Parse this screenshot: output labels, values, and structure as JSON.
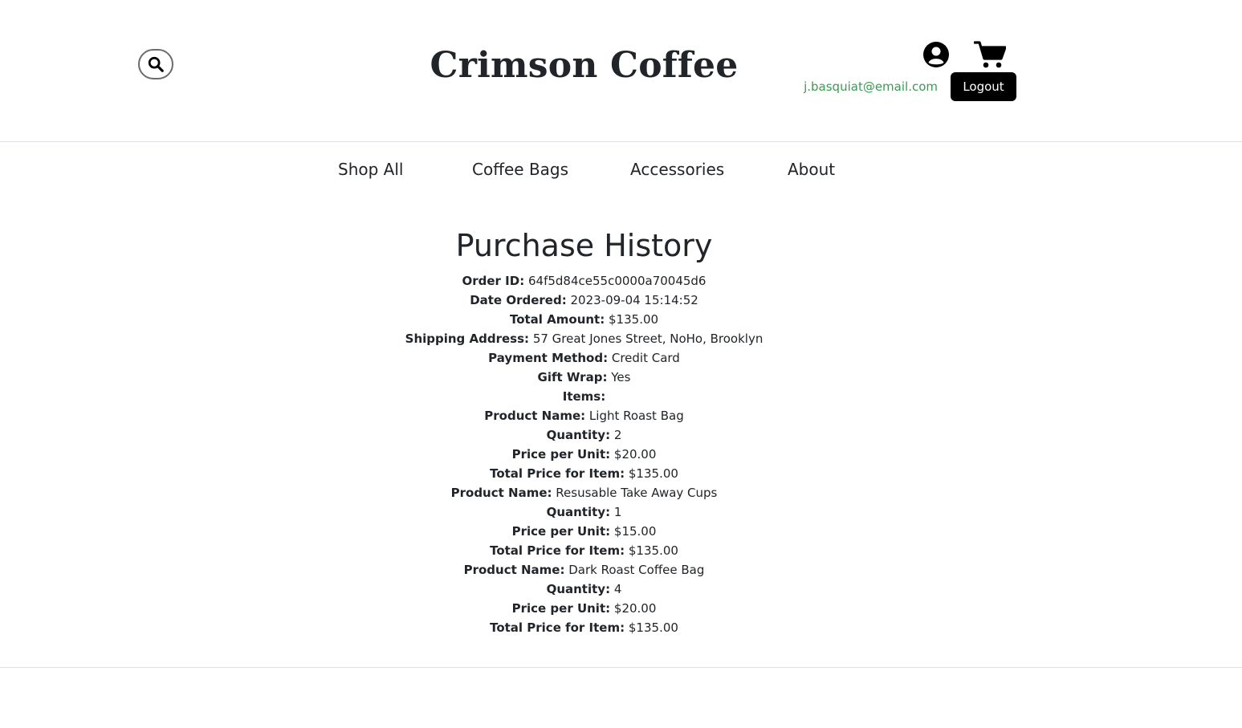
{
  "header": {
    "brand": "Crimson Coffee",
    "user_email": "j.basquiat@email.com",
    "logout_label": "Logout",
    "icons": [
      "search-icon",
      "account-icon",
      "cart-icon"
    ]
  },
  "nav": {
    "items": [
      {
        "label": "Shop All"
      },
      {
        "label": "Coffee Bags"
      },
      {
        "label": "Accessories"
      },
      {
        "label": "About"
      }
    ]
  },
  "main": {
    "title": "Purchase History",
    "order": {
      "order_id_label": "Order ID:",
      "order_id": "64f5d84ce55c0000a70045d6",
      "date_label": "Date Ordered:",
      "date": "2023-09-04 15:14:52",
      "total_label": "Total Amount:",
      "total": "$135.00",
      "address_label": "Shipping Address:",
      "address": "57 Great Jones Street, NoHo, Brooklyn",
      "payment_label": "Payment Method:",
      "payment": "Credit Card",
      "gift_label": "Gift Wrap:",
      "gift": "Yes",
      "items_label": "Items:",
      "item_labels": {
        "name": "Product Name:",
        "quantity": "Quantity:",
        "price": "Price per Unit:",
        "total": "Total Price for Item:"
      },
      "items": [
        {
          "name": "Light Roast Bag",
          "quantity": "2",
          "price": "$20.00",
          "total": "$135.00"
        },
        {
          "name": "Resusable Take Away Cups",
          "quantity": "1",
          "price": "$15.00",
          "total": "$135.00"
        },
        {
          "name": "Dark Roast Coffee Bag",
          "quantity": "4",
          "price": "$20.00",
          "total": "$135.00"
        }
      ]
    }
  },
  "colors": {
    "email": "#3b9a53",
    "logout_bg": "#000000",
    "text": "#212529"
  }
}
